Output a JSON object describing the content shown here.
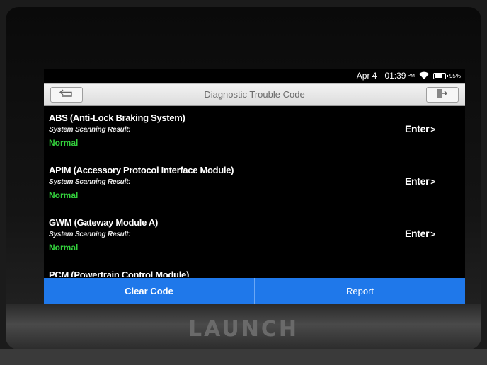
{
  "status": {
    "date": "Apr 4",
    "time": "01:39",
    "ampm": "PM",
    "battery": "95%",
    "battery_level": 0.95
  },
  "header": {
    "title": "Diagnostic Trouble Code",
    "back_icon": "back-arrow-icon",
    "exit_icon": "exit-icon"
  },
  "modules": [
    {
      "name": "ABS (Anti-Lock Braking System)",
      "result_label": "System Scanning Result:",
      "status": "Normal",
      "enter": "Enter"
    },
    {
      "name": "APIM (Accessory Protocol Interface Module)",
      "result_label": "System Scanning Result:",
      "status": "Normal",
      "enter": "Enter"
    },
    {
      "name": "GWM (Gateway Module A)",
      "result_label": "System Scanning Result:",
      "status": "Normal",
      "enter": "Enter"
    },
    {
      "name": "PCM (Powertrain Control Module)",
      "result_label": "",
      "status": "",
      "enter": ""
    }
  ],
  "footer": {
    "clear_code": "Clear Code",
    "report": "Report"
  },
  "device": {
    "brand": "LAUNCH"
  },
  "colors": {
    "accent": "#1f78ea",
    "status_ok": "#33d13c"
  }
}
